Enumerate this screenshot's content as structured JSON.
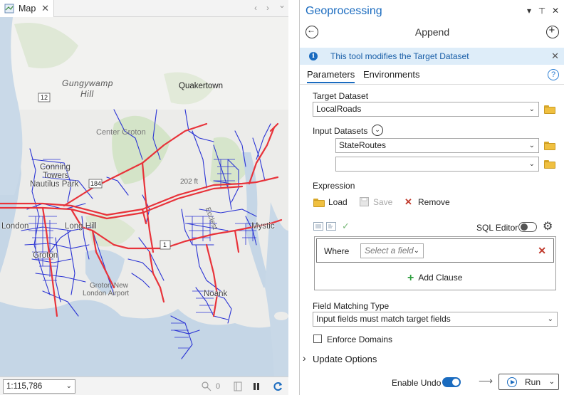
{
  "map_pane": {
    "tab_label": "Map",
    "close_glyph": "✕",
    "nav_left_glyph": "‹",
    "nav_right_glyph": "›",
    "nav_down_glyph": "⌄",
    "labels": {
      "gungywamp_1": "Gungywamp",
      "gungywamp_2": "Hill",
      "quakertown": "Quakertown",
      "center_groton": "Center Groton",
      "conning_1": "Conning",
      "conning_2": "Towers",
      "nautilus_park": "Nautilus Park",
      "elev": "202 ft",
      "london": "London",
      "long_hill": "Long Hill",
      "mystic": "Mystic",
      "groton": "Groton",
      "airport_1": "Groton-New",
      "airport_2": "London Airport",
      "noank": "Noank",
      "ecc": "Ecclest",
      "route_12": "12",
      "route_184": "184",
      "route_1": "1"
    },
    "scale": "1:115,786",
    "status_count": "0"
  },
  "gp_pane": {
    "title": "Geoprocessing",
    "header_dropdown_glyph": "▾",
    "header_pin_glyph": "⊥",
    "header_close_glyph": "✕",
    "tool_name": "Append",
    "back_glyph": "←",
    "add_glyph": "+",
    "info_icon_glyph": "i",
    "info_text": "This tool modifies the Target Dataset",
    "info_close_glyph": "✕",
    "tabs": {
      "parameters": "Parameters",
      "environments": "Environments"
    },
    "help_glyph": "?",
    "target_dataset": {
      "label": "Target Dataset",
      "value": "LocalRoads"
    },
    "input_datasets": {
      "label": "Input Datasets",
      "expand_glyph": "⌄",
      "items": [
        "StateRoutes",
        ""
      ]
    },
    "expression": {
      "label": "Expression",
      "load": "Load",
      "save": "Save",
      "remove": "Remove",
      "remove_glyph": "✕",
      "sql_editor_label": "SQL Editor",
      "gear_glyph": "⚙",
      "check_glyph": "✓",
      "where_label": "Where",
      "field_placeholder": "Select a field",
      "clause_remove_glyph": "✕",
      "add_clause": "Add Clause",
      "add_clause_glyph": "+"
    },
    "field_matching": {
      "label": "Field Matching Type",
      "value": "Input fields must match target fields"
    },
    "enforce_domains": "Enforce Domains",
    "update_options": "Update Options",
    "update_options_glyph": "›",
    "enable_undo": "Enable Undo",
    "arrow_glyph": "⟶",
    "run": "Run",
    "chevron_glyph": "⌄"
  },
  "colors": {
    "accent": "#1a6bbf",
    "state_routes": "#e8333a",
    "local_roads": "#2b34d4",
    "remove_x": "#c0392b",
    "add_plus": "#2e9e3e"
  }
}
